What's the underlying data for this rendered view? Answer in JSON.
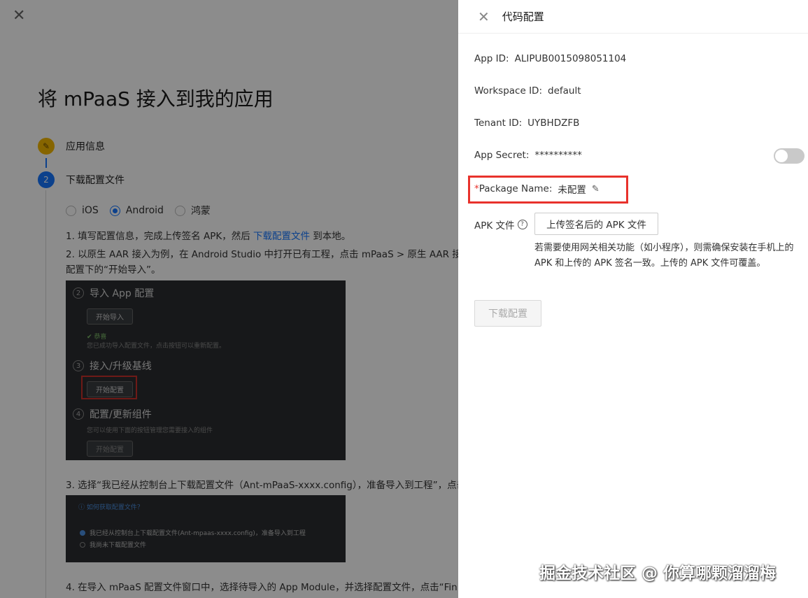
{
  "background": {
    "title": "将 mPaaS 接入到我的应用",
    "steps": [
      {
        "num": "✎",
        "label": "应用信息"
      },
      {
        "num": "2",
        "label": "下载配置文件"
      }
    ],
    "platforms": [
      {
        "label": "iOS",
        "selected": false
      },
      {
        "label": "Android",
        "selected": true
      },
      {
        "label": "鸿蒙",
        "selected": false
      }
    ],
    "instructions": {
      "line1_prefix": "1. 填写配置信息，完成上传签名 APK，然后 ",
      "line1_link": "下载配置文件",
      "line1_suffix": " 到本地。",
      "line2": "2. 以原生 AAR 接入为例，在 Android Studio 中打开已有工程，点击 mPaaS > 原生 AAR 接入",
      "line2b": "配置下的“开始导入”。",
      "line3": "3. 选择“我已经从控制台上下载配置文件（Ant-mPaaS-xxxx.config），准备导入到工程”，点击",
      "line4": "4. 在导入 mPaaS 配置文件窗口中，选择待导入的 App Module，并选择配置文件，点击“Fin"
    },
    "screenshot1": {
      "sec1_num": "2",
      "sec1_title": "导入 App 配置",
      "sec1_btn": "开始导入",
      "sec1_ok": "✔ 恭喜",
      "sec1_note": "您已成功导入配置文件，点击按钮可以重新配置。",
      "sec2_num": "3",
      "sec2_title": "接入/升级基线",
      "sec2_btn": "开始配置",
      "sec3_num": "4",
      "sec3_title": "配置/更新组件",
      "sec3_note": "您可以使用下面的按钮管理您需要接入的组件",
      "sec3_btn": "开始配置"
    },
    "screenshot2": {
      "link": "ⓘ 如何获取配置文件？",
      "opt1": "我已经从控制台上下载配置文件(Ant-mpaas-xxxx.config)，准备导入到工程",
      "opt2": "我尚未下载配置文件"
    }
  },
  "drawer": {
    "title": "代码配置",
    "app_id_label": "App ID:",
    "app_id": "ALIPUB0015098051104",
    "workspace_label": "Workspace ID:",
    "workspace": "default",
    "tenant_label": "Tenant ID:",
    "tenant": "UYBHDZFB",
    "secret_label": "App Secret:",
    "secret": "**********",
    "secret_toggle_on": false,
    "package_required": "*",
    "package_label": "Package Name:",
    "package_value": "未配置",
    "apk_label": "APK 文件",
    "upload_label": "上传签名后的 APK 文件",
    "hint": "若需要使用网关相关功能（如小程序），则需确保安装在手机上的 APK 和上传的 APK 签名一致。上传的 APK 文件可覆盖。",
    "download_label": "下载配置"
  },
  "watermark": "掘金技术社区 @ 你算哪颗溜溜梅",
  "icons": {
    "close": "close-icon",
    "edit": "edit-icon",
    "help": "help-icon"
  }
}
